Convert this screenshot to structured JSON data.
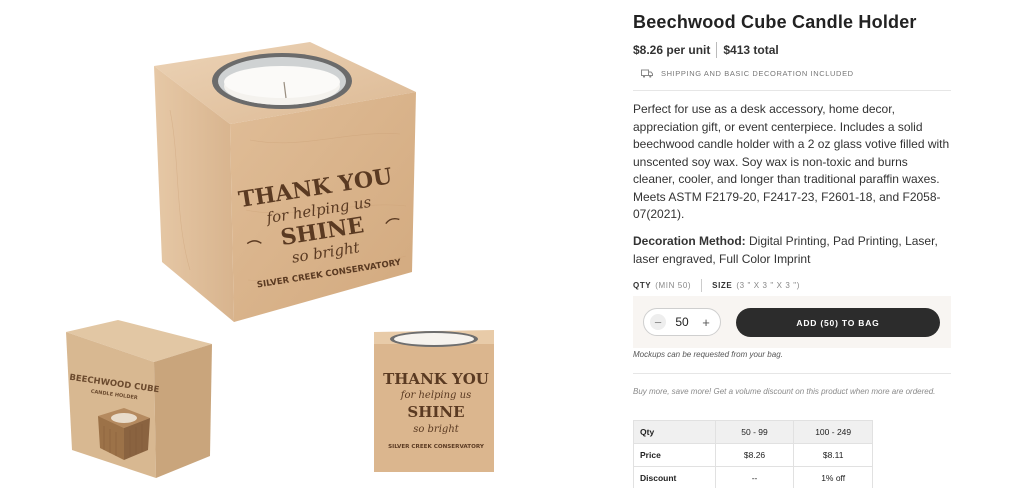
{
  "product": {
    "title": "Beechwood Cube Candle Holder",
    "unit_price": "$8.26 per unit",
    "total_price": "$413 total",
    "shipping_note": "SHIPPING AND BASIC DECORATION INCLUDED",
    "description": "Perfect for use as a desk accessory, home decor, appreciation gift, or event centerpiece. Includes a solid beechwood candle holder with a 2 oz glass votive filled with unscented soy wax. Soy wax is non-toxic and burns cleaner, cooler, and longer than traditional paraffin waxes. Meets ASTM F2179-20, F2417-23, F2601-18, and F2058-07(2021).",
    "decoration_label": "Decoration Method:",
    "decoration_value": " Digital Printing, Pad Printing, Laser, laser engraved, Full Color Imprint"
  },
  "images": {
    "engraving": {
      "line1": "THANK YOU",
      "line2": "for helping us",
      "line3": "SHINE",
      "line4": "so bright",
      "line5": "SILVER CREEK CONSERVATORY"
    },
    "box_print": {
      "line1": "BEECHWOOD CUBE",
      "line2": "CANDLE HOLDER"
    }
  },
  "options": {
    "qty_label": "QTY",
    "qty_min": "(MIN 50)",
    "size_label": "SIZE",
    "size_value": "(3 \" X 3 \" X 3 \")"
  },
  "cart": {
    "minus_symbol": "−",
    "plus_symbol": "+",
    "quantity": "50",
    "add_button_label": "ADD (50) TO BAG",
    "mockup_note": "Mockups can be requested from your bag.",
    "volume_note": "Buy more, save more! Get a volume discount on this product when more are ordered."
  },
  "pricing_table": {
    "header": [
      "Qty",
      "50 - 99",
      "100 - 249"
    ],
    "rows": [
      {
        "label": "Price",
        "values": [
          "$8.26",
          "$8.11"
        ]
      },
      {
        "label": "Discount",
        "values": [
          "--",
          "1% off"
        ]
      }
    ]
  },
  "colors": {
    "accent_dark": "#2c2c2c",
    "wood": "#d9b48c",
    "panel_bg": "#f8f5f2"
  },
  "icons": {
    "shipping": "truck-icon",
    "decrease": "minus-icon",
    "increase": "plus-icon"
  }
}
